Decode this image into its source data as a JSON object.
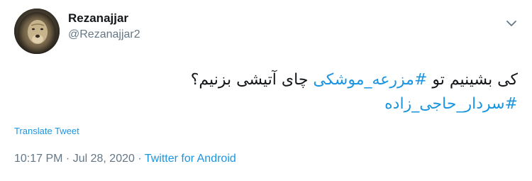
{
  "user": {
    "display_name": "Rezanajjar",
    "handle": "@Rezanajjar2",
    "avatar_icon": "lion-avatar"
  },
  "tweet": {
    "line1": {
      "before": "کی بشینیم تو ",
      "hashtag": "#مزرعه_موشکی",
      "after": "  چای آتیشی بزنیم؟"
    },
    "line2": {
      "hashtag": "#سردار_حاجی_زاده"
    }
  },
  "translate_label": "Translate Tweet",
  "meta": {
    "time": "10:17 PM",
    "separator": " · ",
    "date": "Jul 28, 2020",
    "source": "Twitter for Android"
  },
  "menu_icon": "chevron-down-icon",
  "colors": {
    "link": "#1b95e0",
    "secondary": "#657786",
    "text": "#14171a"
  }
}
